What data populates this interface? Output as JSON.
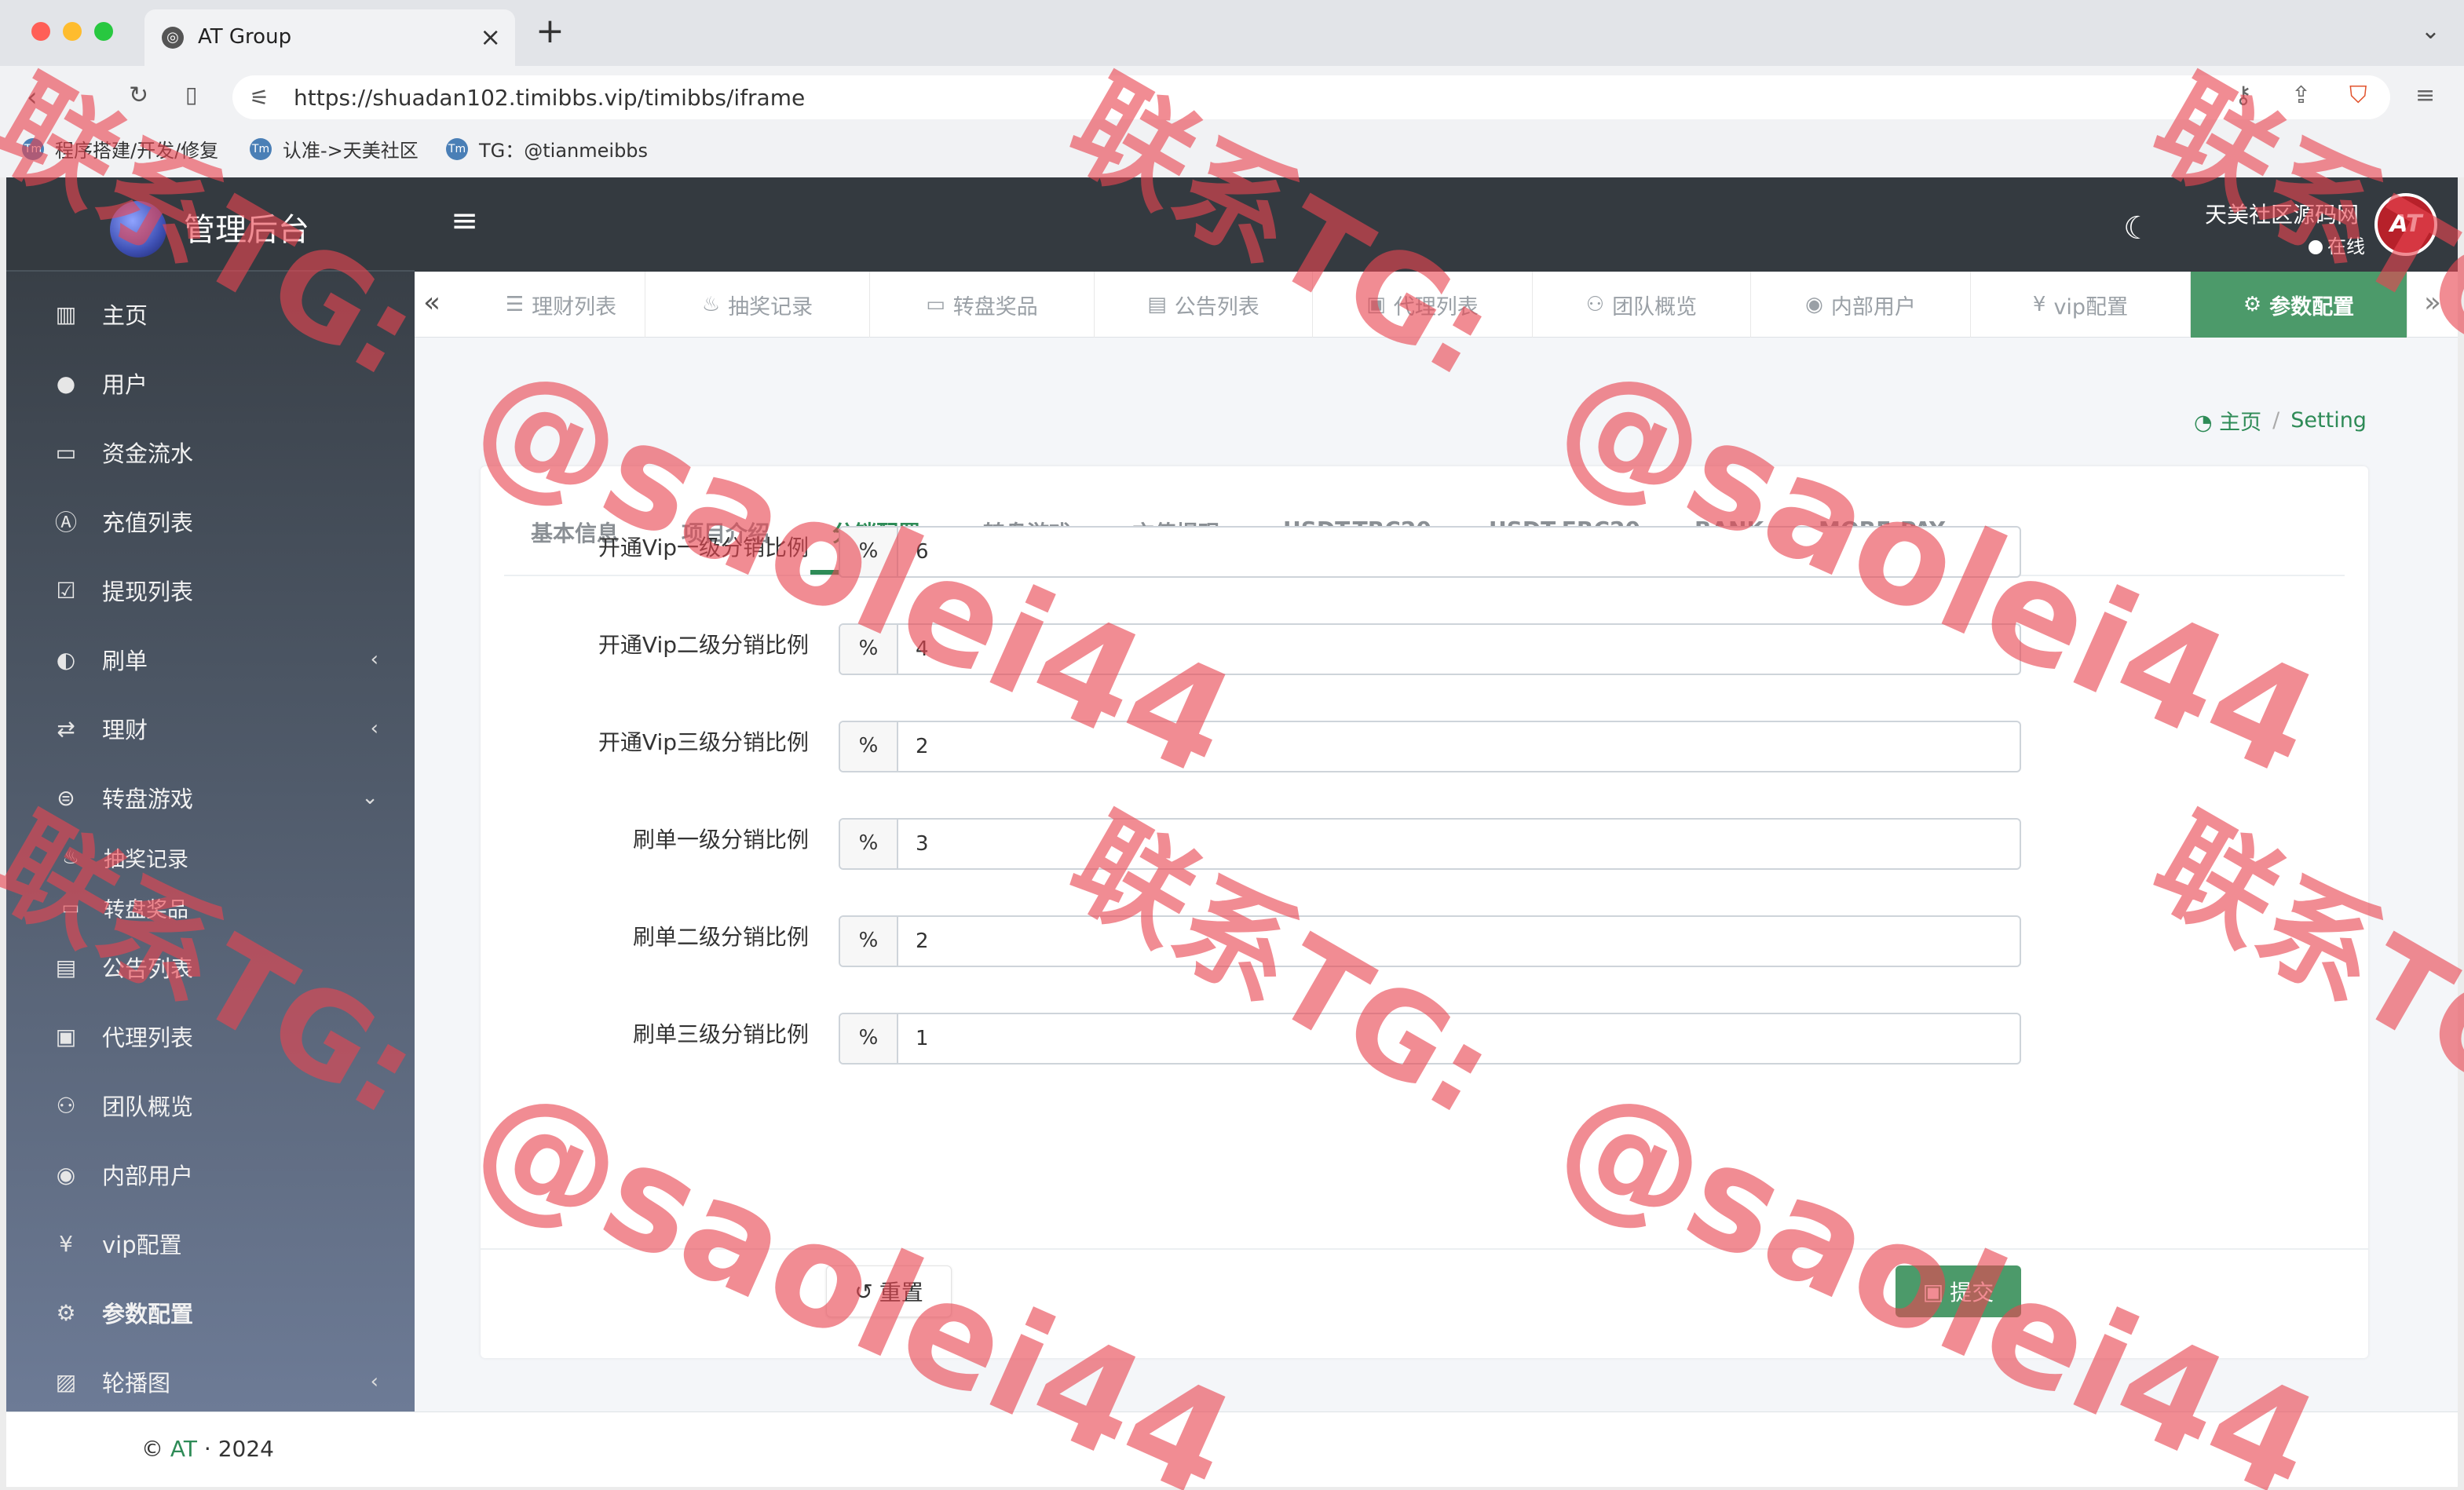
{
  "browser": {
    "tab_title": "AT Group",
    "url": "https://shuadan102.timibbs.vip/timibbs/iframe",
    "bookmarks": [
      "程序搭建/开发/修复",
      "认准->天美社区",
      "TG：@tianmeibbs"
    ]
  },
  "brand": {
    "name": "管理后台"
  },
  "header": {
    "user_name": "天美社区源码网",
    "status": "在线",
    "avatar_text": "AT"
  },
  "sidebar": {
    "items": [
      {
        "label": "主页",
        "icon": "bar-chart-icon"
      },
      {
        "label": "用户",
        "icon": "user-icon"
      },
      {
        "label": "资金流水",
        "icon": "money-icon"
      },
      {
        "label": "充值列表",
        "icon": "letter-a-icon"
      },
      {
        "label": "提现列表",
        "icon": "checkbox-icon"
      },
      {
        "label": "刷单",
        "icon": "half-circle-icon",
        "arrow": "‹"
      },
      {
        "label": "理财",
        "icon": "exchange-icon",
        "arrow": "‹"
      },
      {
        "label": "转盘游戏",
        "icon": "gamepad-icon",
        "arrow": "⌄"
      },
      {
        "label": "公告列表",
        "icon": "document-icon"
      },
      {
        "label": "代理列表",
        "icon": "id-badge-icon"
      },
      {
        "label": "团队概览",
        "icon": "users-icon"
      },
      {
        "label": "内部用户",
        "icon": "user-circle-icon"
      },
      {
        "label": "vip配置",
        "icon": "yen-icon"
      },
      {
        "label": "参数配置",
        "icon": "cogs-icon"
      },
      {
        "label": "轮播图",
        "icon": "image-icon",
        "arrow": "‹"
      }
    ],
    "sub_items": [
      {
        "label": "抽奖记录",
        "icon": "cake-icon"
      },
      {
        "label": "转盘奖品",
        "icon": "money-icon"
      }
    ]
  },
  "page_tabs": [
    {
      "label": "理财列表",
      "icon": "list-icon"
    },
    {
      "label": "抽奖记录",
      "icon": "cake-icon"
    },
    {
      "label": "转盘奖品",
      "icon": "money-icon"
    },
    {
      "label": "公告列表",
      "icon": "document-icon"
    },
    {
      "label": "代理列表",
      "icon": "id-badge-icon"
    },
    {
      "label": "团队概览",
      "icon": "users-icon"
    },
    {
      "label": "内部用户",
      "icon": "user-circle-icon"
    },
    {
      "label": "vip配置",
      "icon": "yen-icon"
    },
    {
      "label": "参数配置",
      "icon": "cogs-icon",
      "active": true
    }
  ],
  "breadcrumb": {
    "home": "主页",
    "separator": "/",
    "current": "Setting"
  },
  "content_tabs": [
    "基本信息",
    "项目介绍",
    "分销配置",
    "转盘游戏",
    "充值提现",
    "USDT-TRC20",
    "USDT-ERC20",
    "BANK",
    "MORE-PAY"
  ],
  "active_content_tab": "分销配置",
  "form": {
    "addon": "%",
    "fields": [
      {
        "label": "开通Vip一级分销比例",
        "value": "6"
      },
      {
        "label": "开通Vip二级分销比例",
        "value": "4"
      },
      {
        "label": "开通Vip三级分销比例",
        "value": "2"
      },
      {
        "label": "刷单一级分销比例",
        "value": "3"
      },
      {
        "label": "刷单二级分销比例",
        "value": "2"
      },
      {
        "label": "刷单三级分销比例",
        "value": "1"
      }
    ],
    "reset_label": "重置",
    "submit_label": "提交"
  },
  "footer": {
    "copyright": "©",
    "brand": "AT",
    "dot": "·",
    "year": "2024"
  },
  "watermark": {
    "contact": "联系TG:",
    "handle": "@saolei44"
  },
  "colors": {
    "accent": "#4c9a6a",
    "sidebar_dark": "#343a40",
    "watermark": "#e84650"
  }
}
